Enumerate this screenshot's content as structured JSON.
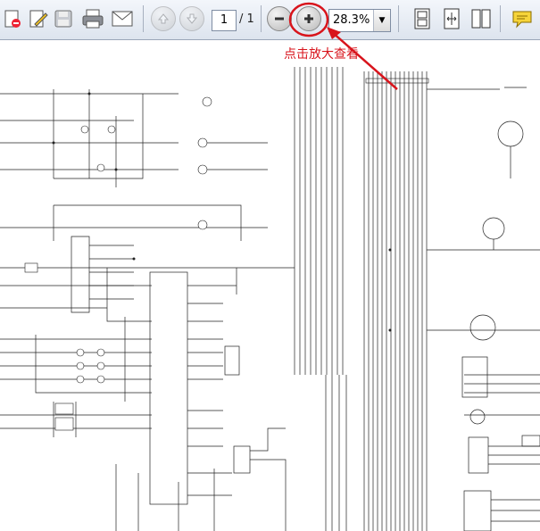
{
  "toolbar": {
    "page_current": "1",
    "page_total": "/ 1",
    "zoom_value": "28.3%",
    "icons": [
      "open-icon",
      "edit-icon",
      "save-icon",
      "print-icon",
      "email-icon",
      "prev-page-icon",
      "next-page-icon",
      "zoom-out-icon",
      "zoom-in-icon",
      "fit-page-icon",
      "fit-width-icon",
      "two-page-icon",
      "comment-icon"
    ]
  },
  "annotation": {
    "text": "点击放大查看",
    "color": "#d8141c"
  },
  "colors": {
    "toolbar_bg": "#e6ebf3",
    "wire": "#222222",
    "annotation": "#d8141c"
  }
}
